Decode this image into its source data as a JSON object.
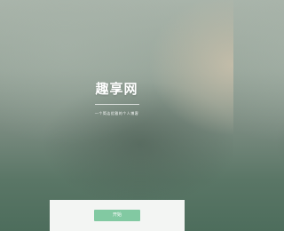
{
  "hero": {
    "title": "趣享网",
    "tagline": "一个简洁优雅的个人博客"
  },
  "panel": {
    "start_button_label": "开始"
  },
  "colors": {
    "accent_button": "#82c9a2",
    "panel_background": "#f3f5f3",
    "title_text": "#ffffff"
  }
}
